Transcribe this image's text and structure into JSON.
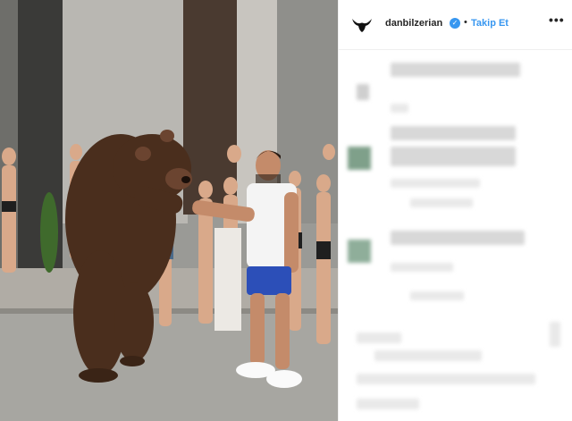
{
  "header": {
    "username": "danbilzerian",
    "verified_mark": "✓",
    "separator": "•",
    "follow_label": "Takip Et",
    "more_label": "•••",
    "avatar_icon": "goat-skull-icon"
  },
  "photo": {
    "description_icon": "post-image"
  },
  "colors": {
    "accent": "#3897f0",
    "text": "#262626",
    "blur_placeholder": "#e9e9e9"
  }
}
